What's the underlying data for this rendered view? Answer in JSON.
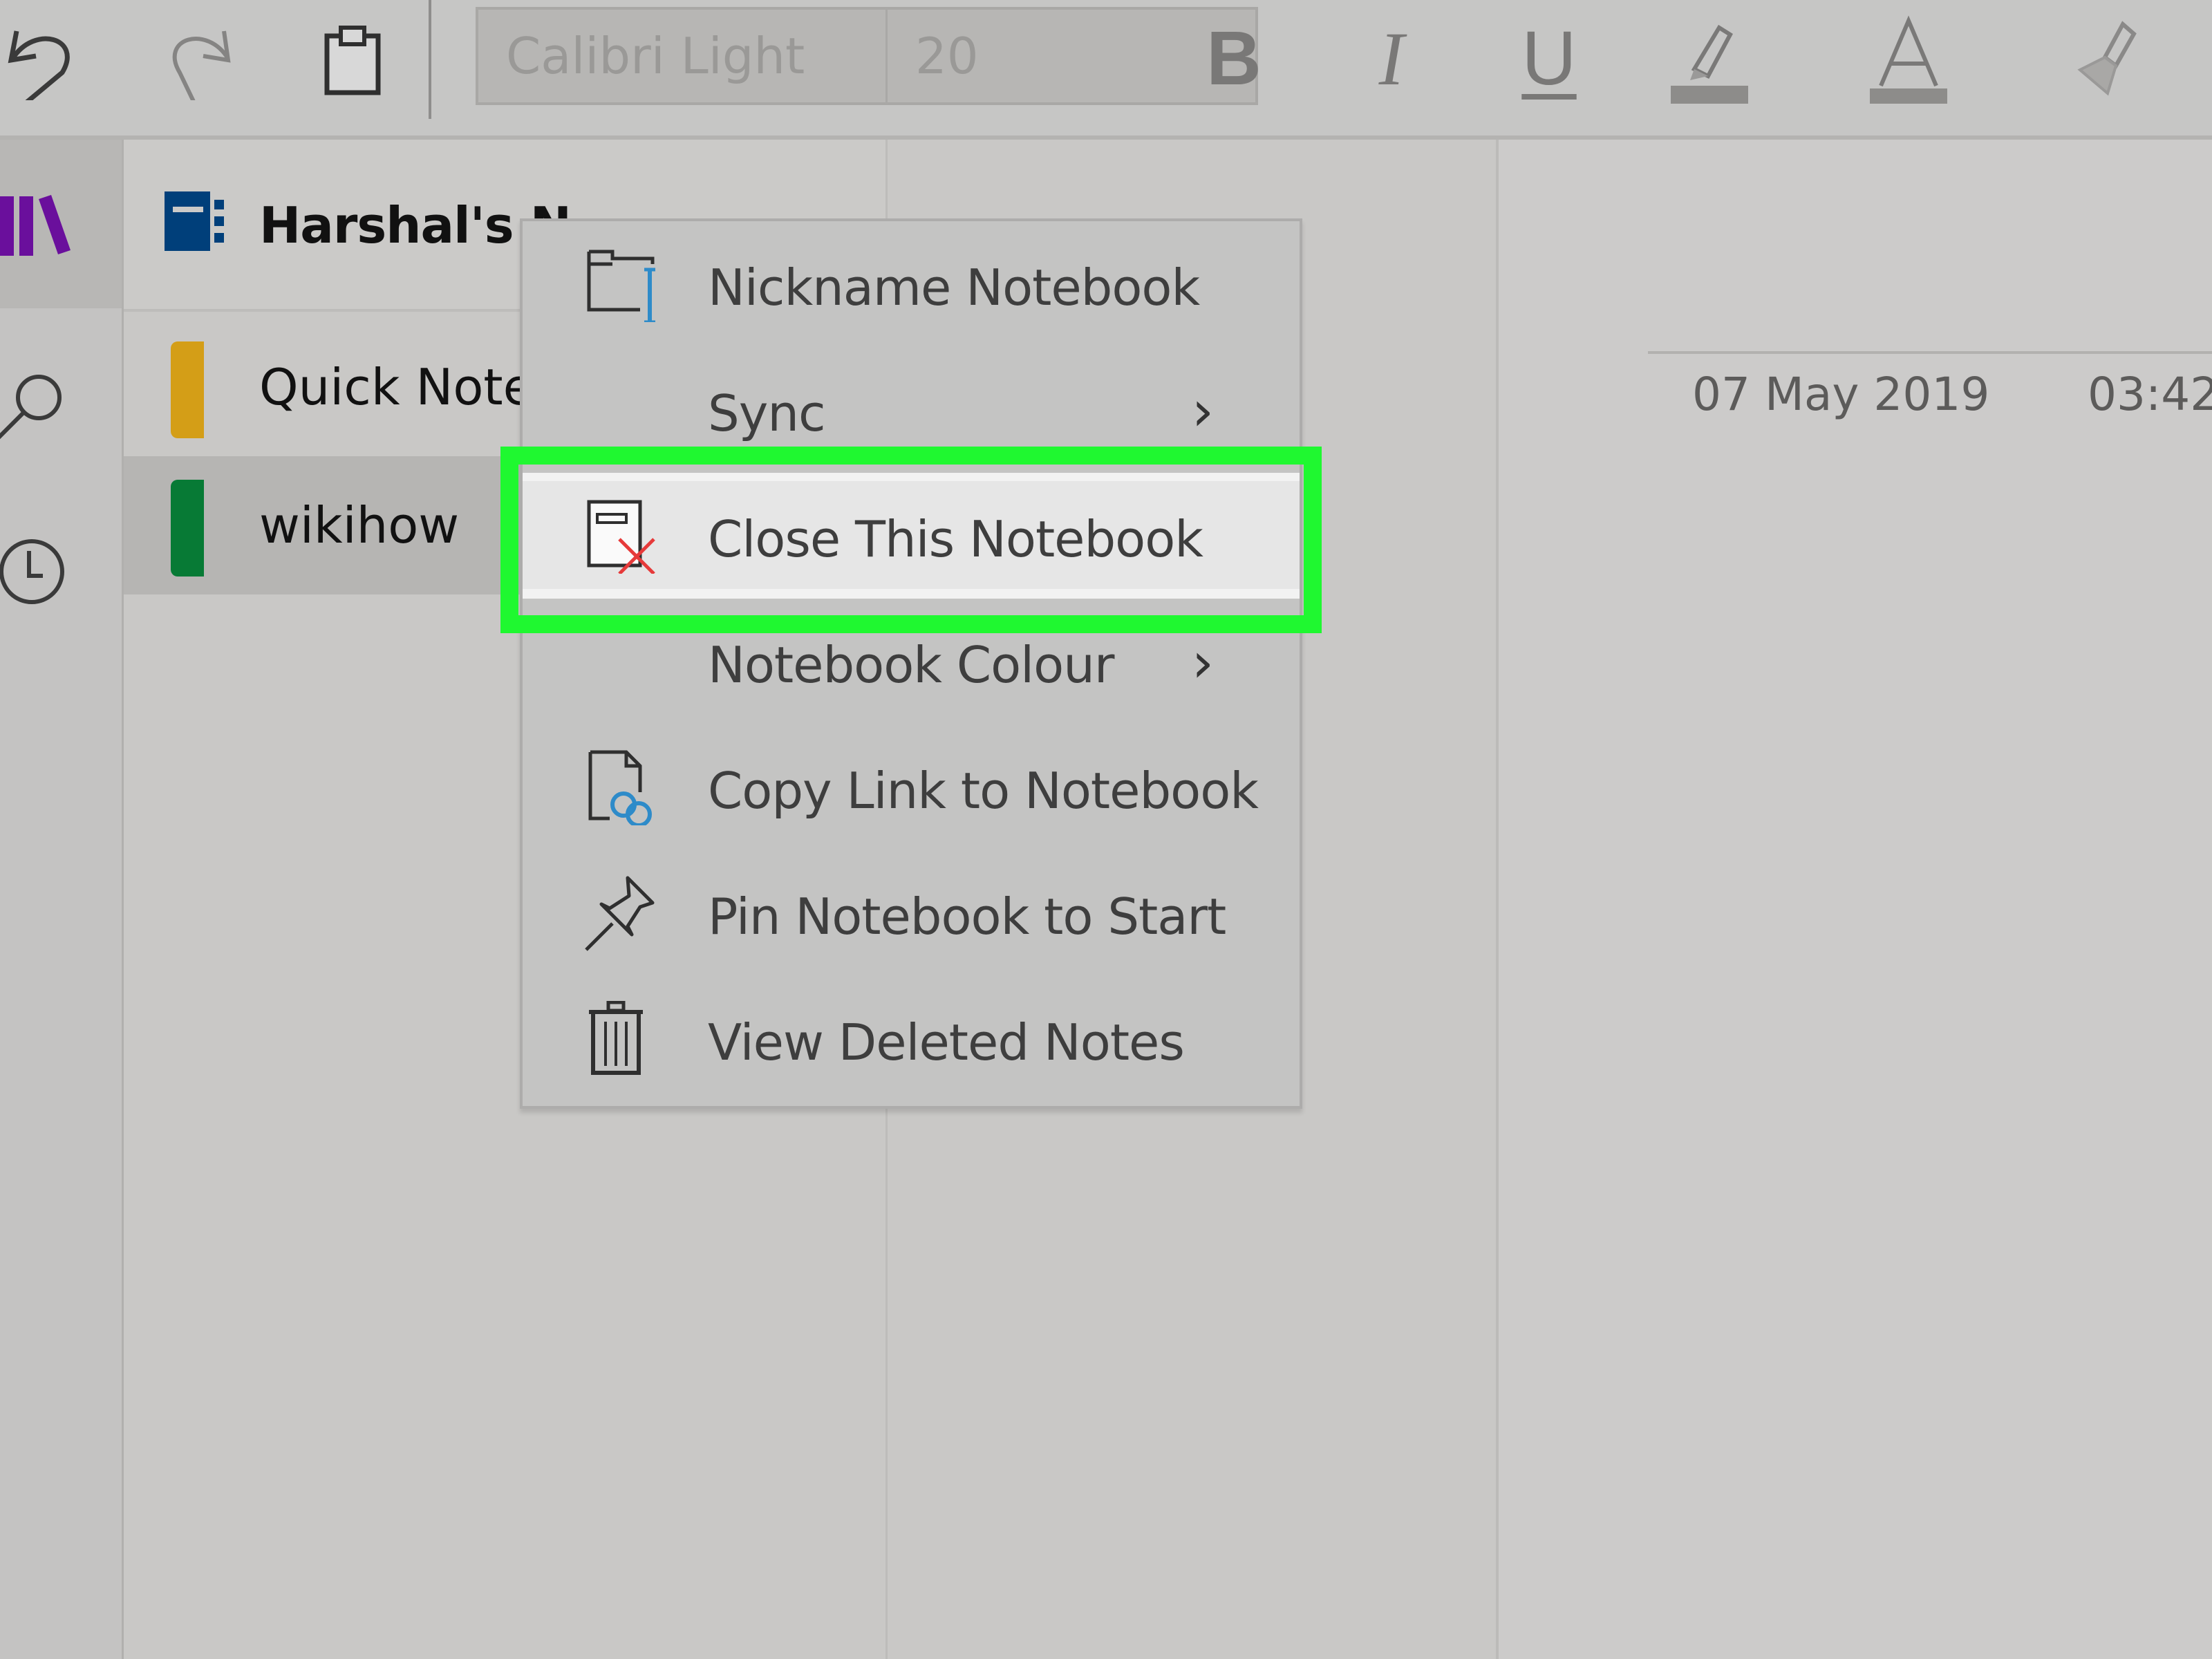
{
  "toolbar": {
    "undo_icon": "undo-icon",
    "redo_icon": "redo-icon",
    "clipboard_icon": "clipboard-icon",
    "font_name": "Calibri Light",
    "font_size": "20",
    "bold_label": "B",
    "italic_label": "I",
    "underline_label": "U",
    "highlight_icon": "highlighter-icon",
    "font_color_label": "A",
    "format_painter_icon": "format-painter-icon"
  },
  "rail": {
    "items": [
      {
        "name": "notebooks",
        "icon": "notebooks-icon",
        "active": true
      },
      {
        "name": "search",
        "icon": "search-icon"
      },
      {
        "name": "recent",
        "icon": "clock-icon"
      }
    ]
  },
  "notebook": {
    "title": "Harshal's Notebook",
    "title_visible": "Harshal's N",
    "icon_color": "#003f7a",
    "sections": [
      {
        "label": "Quick Notes",
        "visible_label": "Quick Note",
        "color": "#d49e17",
        "selected": false
      },
      {
        "label": "wikihow",
        "visible_label": "wikihow",
        "color": "#077a35",
        "selected": true
      }
    ]
  },
  "page": {
    "date": "07 May 2019",
    "time": "03:42"
  },
  "context_menu": {
    "items": [
      {
        "label": "Nickname Notebook",
        "icon": "rename-notebook-icon",
        "submenu": false
      },
      {
        "label": "Sync",
        "icon": "",
        "submenu": true
      },
      {
        "label": "Close This Notebook",
        "icon": "close-notebook-icon",
        "submenu": false,
        "highlighted": true
      },
      {
        "label": "Notebook Colour",
        "icon": "",
        "submenu": true
      },
      {
        "label": "Copy Link to Notebook",
        "icon": "copy-link-icon",
        "submenu": false
      },
      {
        "label": "Pin Notebook to Start",
        "icon": "pin-icon",
        "submenu": false
      },
      {
        "label": "View Deleted Notes",
        "icon": "trash-icon",
        "submenu": false
      }
    ],
    "chevron": "›"
  },
  "colors": {
    "highlight_border": "#1ff830",
    "rail_accent": "#6a0f9c",
    "link_icon_accent": "#2e8bc9",
    "close_icon_accent": "#e63a3a"
  }
}
